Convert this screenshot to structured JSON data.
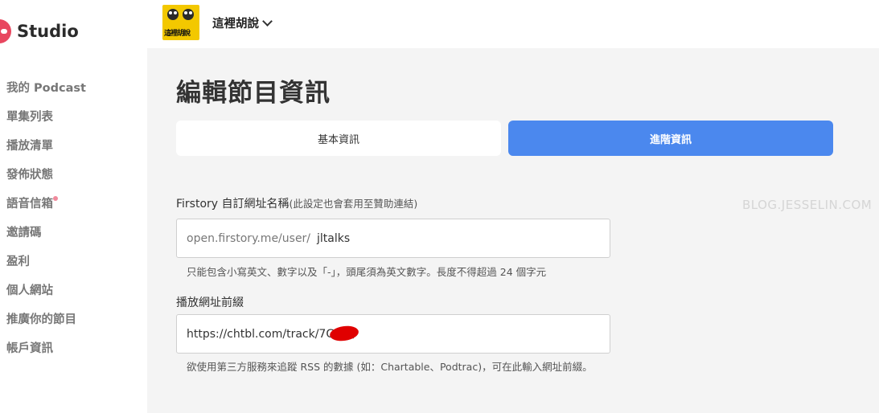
{
  "brand": {
    "name": "Studio",
    "accent": "#e8475f"
  },
  "sidebar": {
    "items": [
      {
        "label": "我的 Podcast"
      },
      {
        "label": "單集列表"
      },
      {
        "label": "播放清單"
      },
      {
        "label": "發佈狀態"
      },
      {
        "label": "語音信箱",
        "badge": true
      },
      {
        "label": "邀請碼"
      },
      {
        "label": "盈利"
      },
      {
        "label": "個人網站"
      },
      {
        "label": "推廣你的節目"
      },
      {
        "label": "帳戶資訊"
      }
    ]
  },
  "header": {
    "show_name": "這裡胡說",
    "cover_text": "這裡胡說",
    "dropdown_icon": "chevron-down-icon"
  },
  "main": {
    "title": "編輯節目資訊",
    "tabs": [
      {
        "label": "基本資訊",
        "active": false
      },
      {
        "label": "進階資訊",
        "active": true,
        "color": "#4b88ee"
      }
    ],
    "fields": {
      "custom_url": {
        "label": "Firstory 自訂網址名稱",
        "sublabel": "(此設定也會套用至贊助連結)",
        "prefix": "open.firstory.me/user/",
        "value": "jltalks",
        "help": "只能包含小寫英文、數字以及「-」，頭尾須為英文數字。長度不得超過 24 個字元"
      },
      "play_prefix": {
        "label": "播放網址前綴",
        "value": "https://chtbl.com/track/7G   15/",
        "help": "欲使用第三方服務來追蹤 RSS 的數據 (如：Chartable、Podtrac)，可在此輸入網址前綴。"
      }
    }
  },
  "watermark": "BLOG.JESSELIN.COM"
}
